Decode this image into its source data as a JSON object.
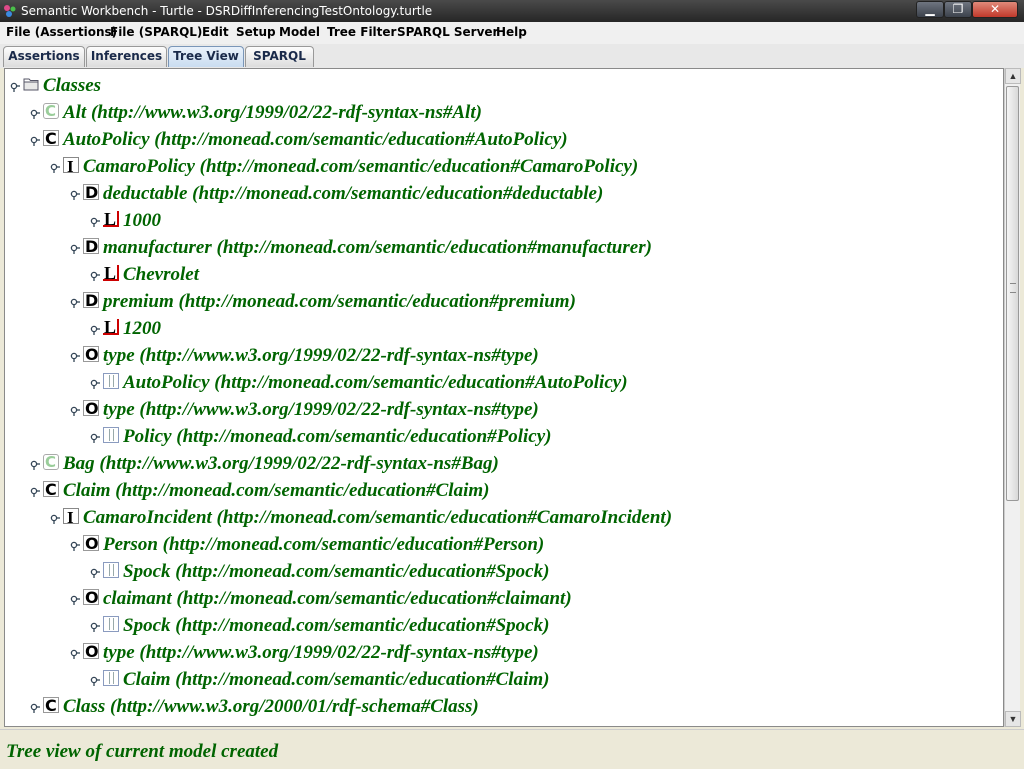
{
  "window": {
    "title": "Semantic Workbench - Turtle - DSRDiffInferencingTestOntology.turtle",
    "min_glyph": "▁",
    "max_glyph": "❐",
    "close_glyph": "✕"
  },
  "menu": [
    "File (Assertions)",
    "File (SPARQL)",
    "Edit",
    "Setup",
    "Model",
    "Tree Filter",
    "SPARQL Server",
    "Help"
  ],
  "tabs": [
    {
      "label": "Assertions",
      "active": false
    },
    {
      "label": "Inferences",
      "active": false
    },
    {
      "label": "Tree View",
      "active": true
    },
    {
      "label": "SPARQL",
      "active": false
    }
  ],
  "tree": [
    {
      "depth": 0,
      "icon": "folder",
      "letter": "",
      "label": "Classes"
    },
    {
      "depth": 1,
      "icon": "G",
      "letter": "C",
      "label": "Alt (http://www.w3.org/1999/02/22-rdf-syntax-ns#Alt)"
    },
    {
      "depth": 1,
      "icon": "C",
      "letter": "C",
      "label": "AutoPolicy (http://monead.com/semantic/education#AutoPolicy)"
    },
    {
      "depth": 2,
      "icon": "I",
      "letter": "I",
      "label": "CamaroPolicy (http://monead.com/semantic/education#CamaroPolicy)"
    },
    {
      "depth": 3,
      "icon": "D",
      "letter": "D",
      "label": "deductable (http://monead.com/semantic/education#deductable)"
    },
    {
      "depth": 4,
      "icon": "L",
      "letter": "L",
      "label": "1000"
    },
    {
      "depth": 3,
      "icon": "D",
      "letter": "D",
      "label": "manufacturer (http://monead.com/semantic/education#manufacturer)"
    },
    {
      "depth": 4,
      "icon": "L",
      "letter": "L",
      "label": "Chevrolet"
    },
    {
      "depth": 3,
      "icon": "D",
      "letter": "D",
      "label": "premium (http://monead.com/semantic/education#premium)"
    },
    {
      "depth": 4,
      "icon": "L",
      "letter": "L",
      "label": "1200"
    },
    {
      "depth": 3,
      "icon": "O",
      "letter": "O",
      "label": "type (http://www.w3.org/1999/02/22-rdf-syntax-ns#type)"
    },
    {
      "depth": 4,
      "icon": "Ic",
      "letter": "",
      "label": "AutoPolicy (http://monead.com/semantic/education#AutoPolicy)"
    },
    {
      "depth": 3,
      "icon": "O",
      "letter": "O",
      "label": "type (http://www.w3.org/1999/02/22-rdf-syntax-ns#type)"
    },
    {
      "depth": 4,
      "icon": "Ic",
      "letter": "",
      "label": "Policy (http://monead.com/semantic/education#Policy)"
    },
    {
      "depth": 1,
      "icon": "G",
      "letter": "C",
      "label": "Bag (http://www.w3.org/1999/02/22-rdf-syntax-ns#Bag)"
    },
    {
      "depth": 1,
      "icon": "C",
      "letter": "C",
      "label": "Claim (http://monead.com/semantic/education#Claim)"
    },
    {
      "depth": 2,
      "icon": "I",
      "letter": "I",
      "label": "CamaroIncident (http://monead.com/semantic/education#CamaroIncident)"
    },
    {
      "depth": 3,
      "icon": "O",
      "letter": "O",
      "label": "Person (http://monead.com/semantic/education#Person)"
    },
    {
      "depth": 4,
      "icon": "Ic",
      "letter": "",
      "label": "Spock (http://monead.com/semantic/education#Spock)"
    },
    {
      "depth": 3,
      "icon": "O",
      "letter": "O",
      "label": "claimant (http://monead.com/semantic/education#claimant)"
    },
    {
      "depth": 4,
      "icon": "Ic",
      "letter": "",
      "label": "Spock (http://monead.com/semantic/education#Spock)"
    },
    {
      "depth": 3,
      "icon": "O",
      "letter": "O",
      "label": "type (http://www.w3.org/1999/02/22-rdf-syntax-ns#type)"
    },
    {
      "depth": 4,
      "icon": "Ic",
      "letter": "",
      "label": "Claim (http://monead.com/semantic/education#Claim)"
    },
    {
      "depth": 1,
      "icon": "C",
      "letter": "C",
      "label": "Class (http://www.w3.org/2000/01/rdf-schema#Class)"
    }
  ],
  "scrollbar": {
    "up_glyph": "▲",
    "down_glyph": "▼"
  },
  "status": "Tree view of current model created",
  "colors": {
    "label": "#006400",
    "literal_border": "#cc0000",
    "tab_active": "#c9dcf0"
  }
}
